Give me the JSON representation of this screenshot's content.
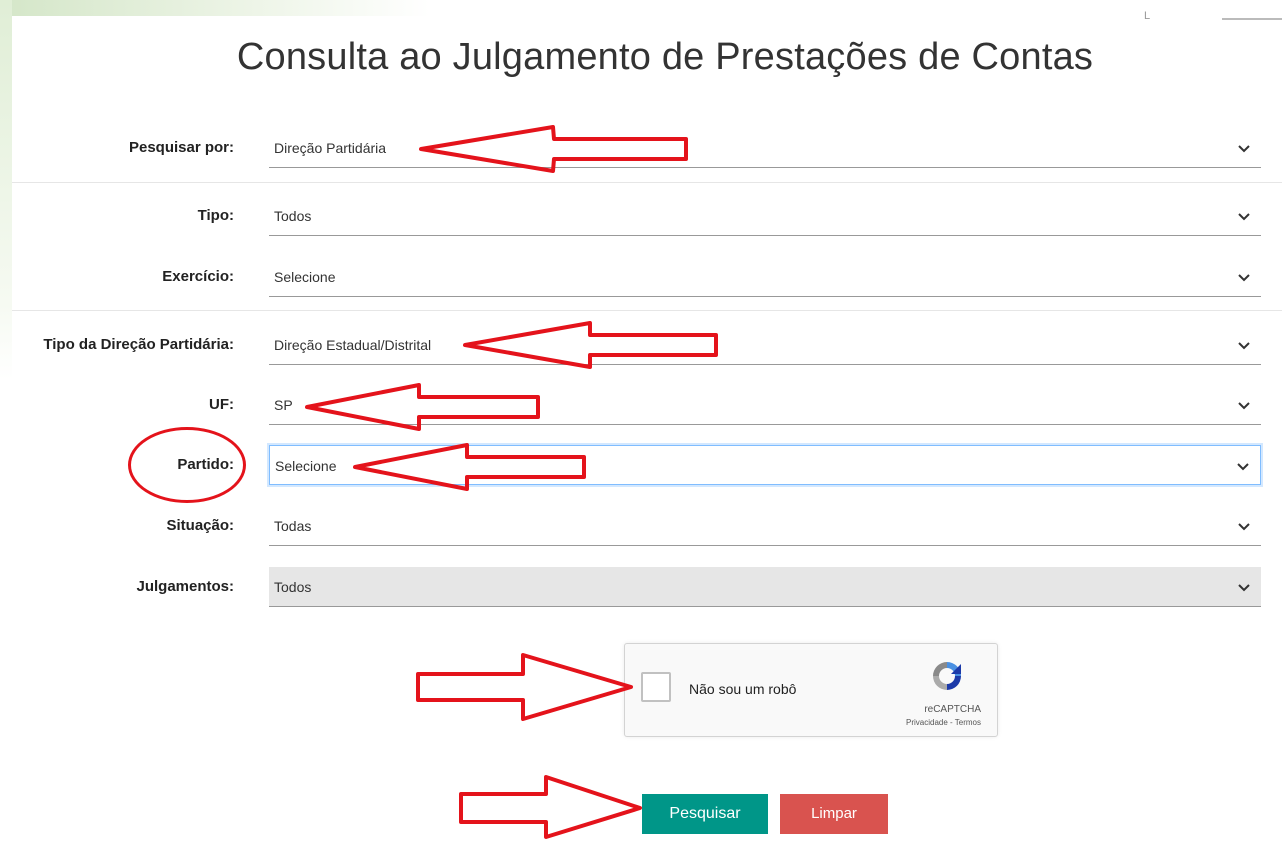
{
  "page": {
    "title": "Consulta ao Julgamento de Prestações de Contas",
    "corner_mark": "L"
  },
  "form": {
    "fields": [
      {
        "label": "Pesquisar por:",
        "value": "Direção Partidária"
      },
      {
        "label": "Tipo:",
        "value": "Todos"
      },
      {
        "label": "Exercício:",
        "value": "Selecione"
      },
      {
        "label": "Tipo da Direção Partidária:",
        "value": "Direção Estadual/Distrital"
      },
      {
        "label": "UF:",
        "value": "SP"
      },
      {
        "label": "Partido:",
        "value": "Selecione",
        "state": "focused"
      },
      {
        "label": "Situação:",
        "value": "Todas"
      },
      {
        "label": "Julgamentos:",
        "value": "Todos",
        "state": "disabled"
      }
    ]
  },
  "captcha": {
    "checkbox_label": "Não sou um robô",
    "brand": "reCAPTCHA",
    "terms": "Privacidade - Termos"
  },
  "buttons": {
    "search": "Pesquisar",
    "clear": "Limpar"
  },
  "colors": {
    "annotation": "#e4131b",
    "search_button": "#009688",
    "clear_button": "#d9534f",
    "focus_border": "#80bdff"
  },
  "icons": [
    "chevron-down-icon",
    "recaptcha-logo-icon",
    "annotation-arrow",
    "annotation-circle"
  ]
}
